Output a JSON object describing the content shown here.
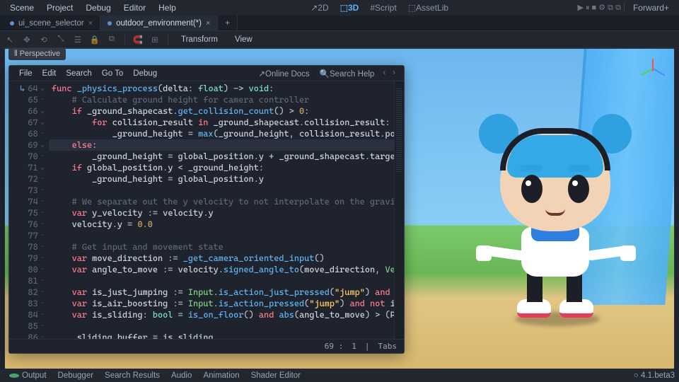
{
  "menu": [
    "Scene",
    "Project",
    "Debug",
    "Editor",
    "Help"
  ],
  "workspaces": [
    {
      "label": "2D",
      "active": false
    },
    {
      "label": "3D",
      "active": true
    },
    {
      "label": "Script",
      "active": false
    },
    {
      "label": "AssetLib",
      "active": false
    }
  ],
  "render_mode": "Forward+",
  "tabs": [
    {
      "label": "ui_scene_selector",
      "active": false,
      "modified": false
    },
    {
      "label": "outdoor_environment(*)",
      "active": true,
      "modified": true
    }
  ],
  "toolbar_words": {
    "transform": "Transform",
    "view": "View"
  },
  "perspective_label": "Perspective",
  "script_menu": [
    "File",
    "Edit",
    "Search",
    "Go To",
    "Debug"
  ],
  "script_help": {
    "online": "Online Docs",
    "search": "Search Help"
  },
  "status": {
    "line": "69",
    "col": "1",
    "indent": "Tabs"
  },
  "code": {
    "start": 64,
    "highlight": 69,
    "lines": [
      {
        "n": 64,
        "fold": "v",
        "seg": [
          [
            "kw",
            "func "
          ],
          [
            "fn",
            "_physics_process"
          ],
          [
            "op",
            "("
          ],
          [
            "id",
            "delta"
          ],
          [
            "op",
            ": "
          ],
          [
            "ty",
            "float"
          ],
          [
            "op",
            ") -> "
          ],
          [
            "ty",
            "void"
          ],
          [
            "op",
            ":"
          ]
        ]
      },
      {
        "n": 65,
        "seg": [
          [
            "cm",
            "    # Calculate ground height for camera controller"
          ]
        ]
      },
      {
        "n": 66,
        "fold": "v",
        "seg": [
          [
            "op",
            "    "
          ],
          [
            "kw",
            "if"
          ],
          [
            "op",
            " "
          ],
          [
            "id",
            "_ground_shapecast"
          ],
          [
            "op",
            "."
          ],
          [
            "fn",
            "get_collision_count"
          ],
          [
            "op",
            "() > "
          ],
          [
            "num",
            "0"
          ],
          [
            "op",
            ":"
          ]
        ]
      },
      {
        "n": 67,
        "fold": "v",
        "seg": [
          [
            "op",
            "        "
          ],
          [
            "kw",
            "for"
          ],
          [
            "op",
            " "
          ],
          [
            "id",
            "collision_result"
          ],
          [
            "op",
            " "
          ],
          [
            "kw",
            "in"
          ],
          [
            "op",
            " "
          ],
          [
            "id",
            "_ground_shapecast"
          ],
          [
            "op",
            "."
          ],
          [
            "id",
            "collision_result"
          ],
          [
            "op",
            ":"
          ]
        ]
      },
      {
        "n": 68,
        "seg": [
          [
            "op",
            "            "
          ],
          [
            "id",
            "_ground_height"
          ],
          [
            "op",
            " = "
          ],
          [
            "fn",
            "max"
          ],
          [
            "op",
            "("
          ],
          [
            "id",
            "_ground_height"
          ],
          [
            "op",
            ", "
          ],
          [
            "id",
            "collision_result"
          ],
          [
            "op",
            "."
          ],
          [
            "id",
            "poi"
          ]
        ]
      },
      {
        "n": 69,
        "fold": "v",
        "seg": [
          [
            "op",
            "    "
          ],
          [
            "kw",
            "else"
          ],
          [
            "op",
            ":"
          ]
        ]
      },
      {
        "n": 70,
        "seg": [
          [
            "op",
            "        "
          ],
          [
            "id",
            "_ground_height"
          ],
          [
            "op",
            " = "
          ],
          [
            "id",
            "global_position"
          ],
          [
            "op",
            "."
          ],
          [
            "id",
            "y"
          ],
          [
            "op",
            " + "
          ],
          [
            "id",
            "_ground_shapecast"
          ],
          [
            "op",
            "."
          ],
          [
            "id",
            "target"
          ]
        ]
      },
      {
        "n": 71,
        "fold": "v",
        "seg": [
          [
            "op",
            "    "
          ],
          [
            "kw",
            "if"
          ],
          [
            "op",
            " "
          ],
          [
            "id",
            "global_position"
          ],
          [
            "op",
            "."
          ],
          [
            "id",
            "y"
          ],
          [
            "op",
            " < "
          ],
          [
            "id",
            "_ground_height"
          ],
          [
            "op",
            ":"
          ]
        ]
      },
      {
        "n": 72,
        "seg": [
          [
            "op",
            "        "
          ],
          [
            "id",
            "_ground_height"
          ],
          [
            "op",
            " = "
          ],
          [
            "id",
            "global_position"
          ],
          [
            "op",
            "."
          ],
          [
            "id",
            "y"
          ]
        ]
      },
      {
        "n": 73,
        "seg": [
          [
            "op",
            ""
          ]
        ]
      },
      {
        "n": 74,
        "seg": [
          [
            "cm",
            "    # We separate out the y velocity to not interpolate on the gravit"
          ]
        ]
      },
      {
        "n": 75,
        "seg": [
          [
            "op",
            "    "
          ],
          [
            "kw",
            "var"
          ],
          [
            "op",
            " "
          ],
          [
            "id",
            "y_velocity"
          ],
          [
            "op",
            " := "
          ],
          [
            "id",
            "velocity"
          ],
          [
            "op",
            "."
          ],
          [
            "id",
            "y"
          ]
        ]
      },
      {
        "n": 76,
        "seg": [
          [
            "op",
            "    "
          ],
          [
            "id",
            "velocity"
          ],
          [
            "op",
            "."
          ],
          [
            "id",
            "y"
          ],
          [
            "op",
            " = "
          ],
          [
            "num",
            "0.0"
          ]
        ]
      },
      {
        "n": 77,
        "seg": [
          [
            "op",
            ""
          ]
        ]
      },
      {
        "n": 78,
        "seg": [
          [
            "cm",
            "    # Get input and movement state"
          ]
        ]
      },
      {
        "n": 79,
        "seg": [
          [
            "op",
            "    "
          ],
          [
            "kw",
            "var"
          ],
          [
            "op",
            " "
          ],
          [
            "id",
            "move_direction"
          ],
          [
            "op",
            " := "
          ],
          [
            "fn",
            "_get_camera_oriented_input"
          ],
          [
            "op",
            "()"
          ]
        ]
      },
      {
        "n": 80,
        "seg": [
          [
            "op",
            "    "
          ],
          [
            "kw",
            "var"
          ],
          [
            "op",
            " "
          ],
          [
            "id",
            "angle_to_move"
          ],
          [
            "op",
            " := "
          ],
          [
            "id",
            "velocity"
          ],
          [
            "op",
            "."
          ],
          [
            "fn",
            "signed_angle_to"
          ],
          [
            "op",
            "("
          ],
          [
            "id",
            "move_direction"
          ],
          [
            "op",
            ", "
          ],
          [
            "cls",
            "Vec"
          ]
        ]
      },
      {
        "n": 81,
        "seg": [
          [
            "op",
            ""
          ]
        ]
      },
      {
        "n": 82,
        "seg": [
          [
            "op",
            "    "
          ],
          [
            "kw",
            "var"
          ],
          [
            "op",
            " "
          ],
          [
            "id",
            "is_just_jumping"
          ],
          [
            "op",
            " := "
          ],
          [
            "cls",
            "Input"
          ],
          [
            "op",
            "."
          ],
          [
            "fn",
            "is_action_just_pressed"
          ],
          [
            "op",
            "("
          ],
          [
            "str",
            "\"jump\""
          ],
          [
            "op",
            ") "
          ],
          [
            "kw",
            "and"
          ],
          [
            "op",
            " "
          ],
          [
            "id",
            "i"
          ]
        ]
      },
      {
        "n": 83,
        "seg": [
          [
            "op",
            "    "
          ],
          [
            "kw",
            "var"
          ],
          [
            "op",
            " "
          ],
          [
            "id",
            "is_air_boosting"
          ],
          [
            "op",
            " := "
          ],
          [
            "cls",
            "Input"
          ],
          [
            "op",
            "."
          ],
          [
            "fn",
            "is_action_pressed"
          ],
          [
            "op",
            "("
          ],
          [
            "str",
            "\"jump\""
          ],
          [
            "op",
            ") "
          ],
          [
            "kw",
            "and not"
          ],
          [
            "op",
            " "
          ],
          [
            "id",
            "is"
          ]
        ]
      },
      {
        "n": 84,
        "seg": [
          [
            "op",
            "    "
          ],
          [
            "kw",
            "var"
          ],
          [
            "op",
            " "
          ],
          [
            "id",
            "is_sliding"
          ],
          [
            "op",
            ": "
          ],
          [
            "ty",
            "bool"
          ],
          [
            "op",
            " = "
          ],
          [
            "fn",
            "is_on_floor"
          ],
          [
            "op",
            "() "
          ],
          [
            "kw",
            "and"
          ],
          [
            "op",
            " "
          ],
          [
            "fn",
            "abs"
          ],
          [
            "op",
            "("
          ],
          [
            "id",
            "angle_to_move"
          ],
          [
            "op",
            ") > ("
          ],
          [
            "id",
            "PI"
          ]
        ]
      },
      {
        "n": 85,
        "seg": [
          [
            "op",
            ""
          ]
        ]
      },
      {
        "n": 86,
        "seg": [
          [
            "op",
            "    "
          ],
          [
            "id",
            "_sliding_buffer"
          ],
          [
            "op",
            " = "
          ],
          [
            "id",
            "is_sliding"
          ]
        ]
      }
    ]
  },
  "bottom_panels": [
    "Output",
    "Debugger",
    "Search Results",
    "Audio",
    "Animation",
    "Shader Editor"
  ],
  "version": "4.1.beta3"
}
